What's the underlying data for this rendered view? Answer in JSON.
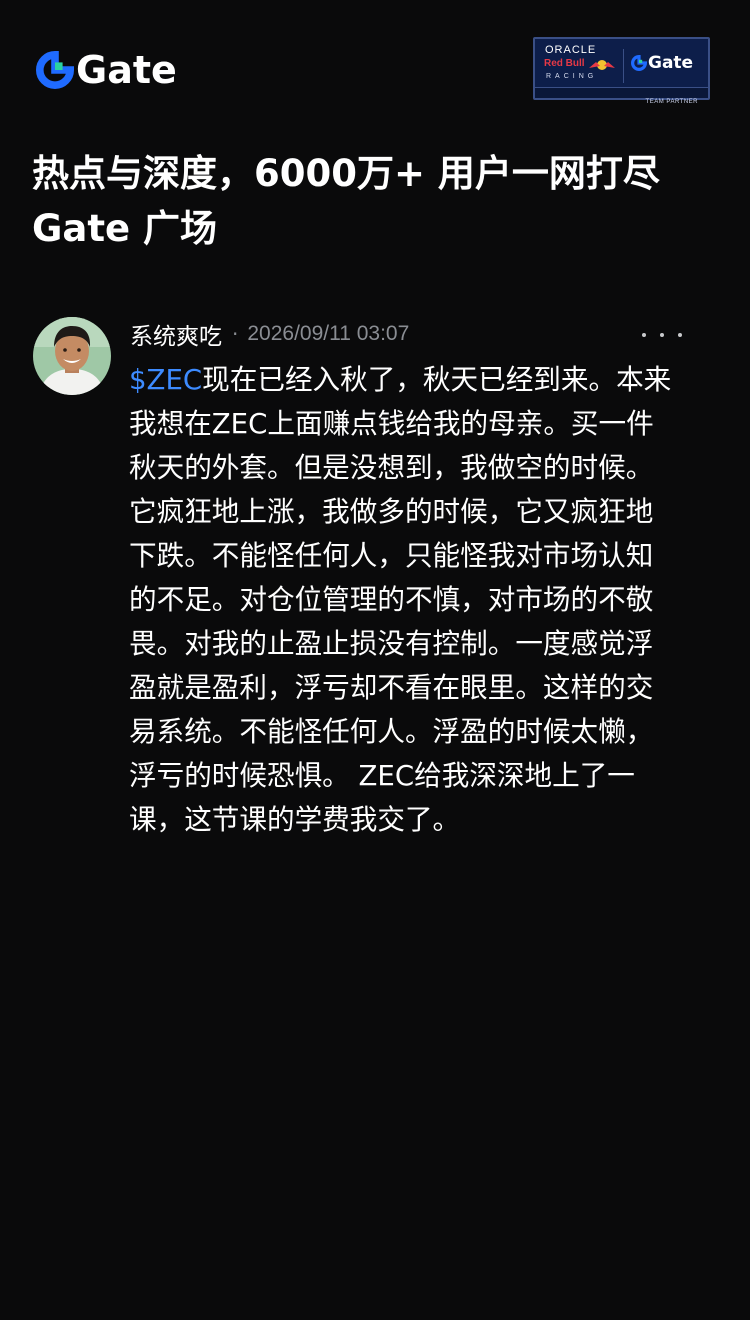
{
  "header": {
    "brand_name": "Gate",
    "brand_color": "#1f6bff",
    "accent_color": "#2bd3a0",
    "partner": {
      "oracle": "ORACLE",
      "redbull": "Red Bull",
      "racing": "RACING",
      "gate": "Gate",
      "footer": "TEAM PARTNER"
    }
  },
  "headline": {
    "line1": "热点与深度，6000万+ 用户一网打尽",
    "line2": "Gate 广场"
  },
  "post": {
    "author": "系统爽吃",
    "separator": "·",
    "timestamp": "2026/09/11 03:07",
    "more_icon": "more-horizontal-icon",
    "ticker": "$ZEC",
    "ticker_color": "#3d8bff",
    "lines": [
      "现在已经入秋了，秋天已经到来。本来",
      "我想在ZEC上面赚点钱给我的母亲。买一件",
      "秋天的外套。但是没想到，我做空的时候。",
      "它疯狂地上涨，我做多的时候，它又疯狂地",
      "下跌。不能怪任何人，只能怪我对市场认知",
      "的不足。对仓位管理的不慎，对市场的不敬",
      "畏。对我的止盈止损没有控制。一度感觉浮",
      "盈就是盈利，浮亏却不看在眼里。这样的交",
      "易系统。不能怪任何人。浮盈的时候太懒，",
      "浮亏的时候恐惧。 ZEC给我深深地上了一",
      "课，这节课的学费我交了。"
    ]
  }
}
